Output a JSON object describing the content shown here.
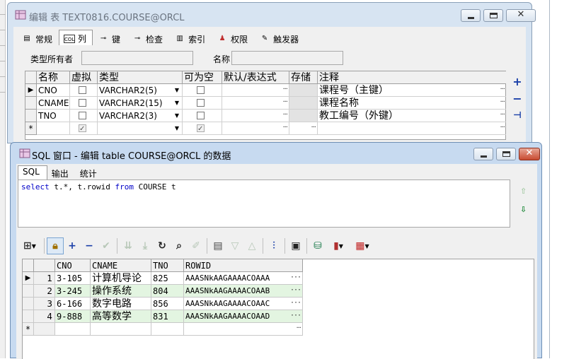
{
  "edit_window": {
    "title": "编辑 表 TEXT0816.COURSE@ORCL",
    "tabs": [
      {
        "label": "常规",
        "icon": "general-icon"
      },
      {
        "label": "列",
        "icon": "columns-icon"
      },
      {
        "label": "键",
        "icon": "key-icon"
      },
      {
        "label": "检查",
        "icon": "check-icon"
      },
      {
        "label": "索引",
        "icon": "index-icon"
      },
      {
        "label": "权限",
        "icon": "privileges-icon"
      },
      {
        "label": "触发器",
        "icon": "trigger-icon"
      }
    ],
    "active_tab": "列",
    "type_owner_label": "类型所有者",
    "type_owner_value": "",
    "name_label": "名称",
    "name_value": "",
    "columns_header": [
      "名称",
      "虚拟",
      "类型",
      "可为空",
      "默认/表达式",
      "存储",
      "注释"
    ],
    "columns_rows": [
      {
        "name": "CNO",
        "virtual": false,
        "type": "VARCHAR2(5)",
        "nullable": false,
        "comment": "课程号（主键）"
      },
      {
        "name": "CNAME",
        "virtual": false,
        "type": "VARCHAR2(15)",
        "nullable": false,
        "comment": "课程名称"
      },
      {
        "name": "TNO",
        "virtual": false,
        "type": "VARCHAR2(3)",
        "nullable": false,
        "comment": "教工编号（外键）"
      }
    ],
    "new_row_marker": "*",
    "current_row_marker": "▶",
    "side_buttons": [
      "+",
      "−",
      "⊣"
    ]
  },
  "sql_window": {
    "title": "SQL 窗口 - 编辑 table COURSE@ORCL 的数据",
    "tabs": [
      "SQL",
      "输出",
      "统计"
    ],
    "active_tab": "SQL",
    "sql_keyword_select": "select",
    "sql_middle": " t.*, t.rowid ",
    "sql_keyword_from": "from",
    "sql_tail": " COURSE t",
    "result_header": [
      "CNO",
      "CNAME",
      "TNO",
      "ROWID"
    ],
    "result_rows": [
      {
        "num": "1",
        "cno": "3-105",
        "cname": "计算机导论",
        "tno": "825",
        "rowid": "AAASNkAAGAAAACOAAA"
      },
      {
        "num": "2",
        "cno": "3-245",
        "cname": "操作系统",
        "tno": "804",
        "rowid": "AAASNkAAGAAAACOAAB"
      },
      {
        "num": "3",
        "cno": "6-166",
        "cname": "数字电路",
        "tno": "856",
        "rowid": "AAASNkAAGAAAACOAAC"
      },
      {
        "num": "4",
        "cno": "9-888",
        "cname": "高等数学",
        "tno": "831",
        "rowid": "AAASNkAAGAAAACOAAD"
      }
    ],
    "new_row_marker": "*",
    "current_row_marker": "▶"
  },
  "colors": {
    "title_bar": "#d7e4f2",
    "active_title_bar": "#c7daf0",
    "close_red": "#c84b31",
    "row_highlight": "#e3f5e1",
    "sql_keyword": "#0000c8"
  }
}
